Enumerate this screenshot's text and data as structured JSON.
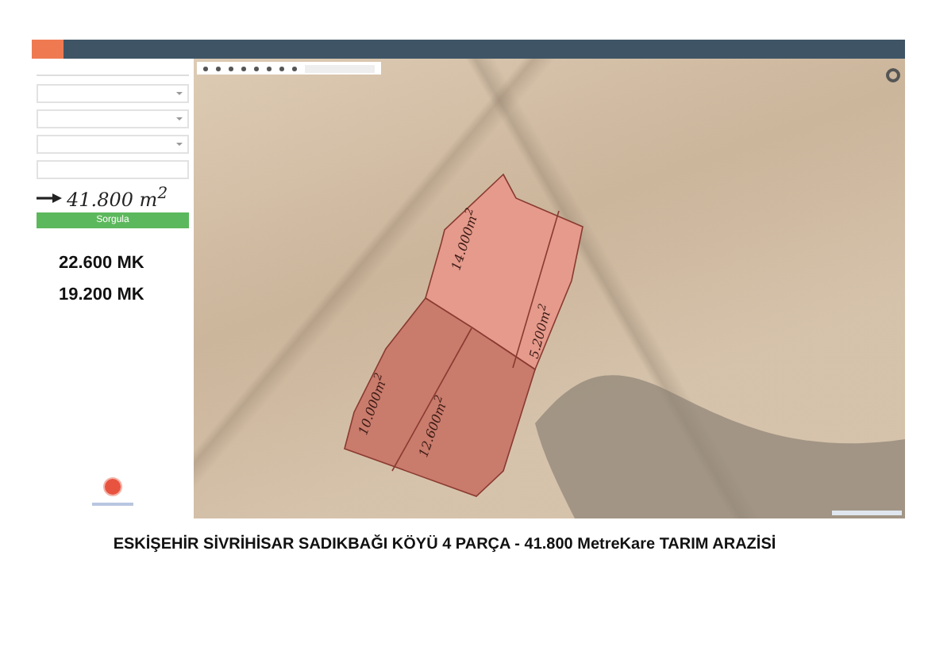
{
  "sidebar": {
    "annotation": "41.800 m$^{2}$",
    "query_button": "Sorgula",
    "totals": [
      "22.600 MK",
      "19.200 MK"
    ]
  },
  "map": {
    "parcels": [
      {
        "label": "14.000m$^{2}$"
      },
      {
        "label": "5.200m$^{2}$"
      },
      {
        "label": "10.000m$^{2}$"
      },
      {
        "label": "12.600m$^{2}$"
      }
    ]
  },
  "caption": "ESKİŞEHİR SİVRİHİSAR SADIKBAĞI KÖYÜ 4 PARÇA - 41.800 MetreKare TARIM ARAZİSİ"
}
